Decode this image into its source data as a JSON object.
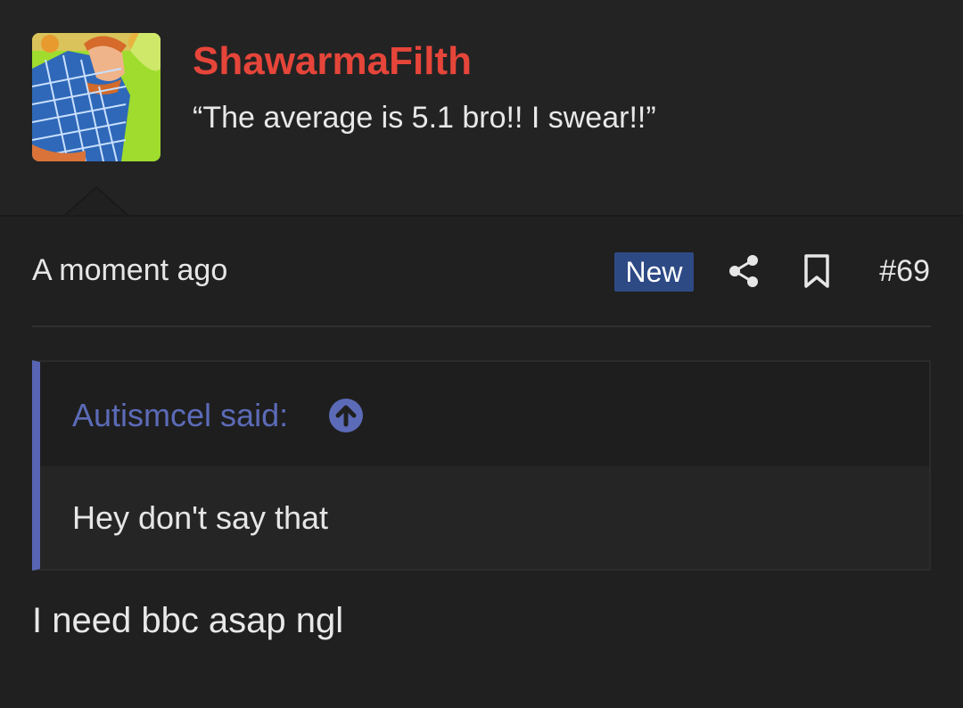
{
  "post": {
    "author": {
      "username": "ShawarmaFilth",
      "user_title": "“The average is 5.1 bro!! I swear!!”",
      "username_color": "#e6453a"
    },
    "meta": {
      "time": "A moment ago",
      "badge": "New",
      "post_number": "#69",
      "icons": [
        "share-icon",
        "bookmark-icon"
      ]
    },
    "quote": {
      "author_label": "Autismcel said:",
      "text": "Hey don't say that",
      "accent_color": "#5865b4",
      "icon": "arrow-up-circle-icon"
    },
    "message": "I need bbc asap ngl"
  }
}
